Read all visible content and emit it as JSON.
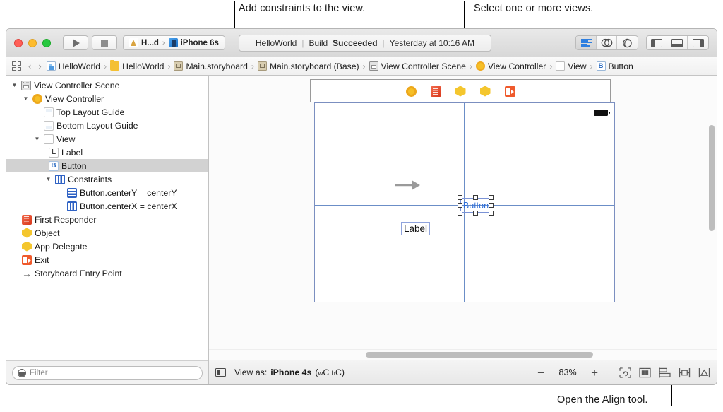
{
  "annotations": [
    {
      "id": "a1",
      "text": "Add constraints to the view."
    },
    {
      "id": "a2",
      "text": "Select one or more views."
    },
    {
      "id": "a3",
      "text": "Open the Align tool."
    }
  ],
  "toolbar": {
    "window_controls": [
      "close",
      "minimize",
      "zoom"
    ],
    "run_label": "Run",
    "stop_label": "Stop",
    "scheme": {
      "target": "H...d",
      "device": "iPhone 6s"
    },
    "status": {
      "project": "HelloWorld",
      "build_prefix": "Build",
      "build_result": "Succeeded",
      "timestamp": "Yesterday at 10:16 AM",
      "separator": "|"
    },
    "editor_modes": [
      {
        "name": "standard-editor",
        "selected": true
      },
      {
        "name": "assistant-editor",
        "selected": false
      },
      {
        "name": "version-editor",
        "selected": false
      }
    ],
    "view_toggles": [
      {
        "name": "navigator-toggle",
        "selected": false
      },
      {
        "name": "debug-area-toggle",
        "selected": false
      },
      {
        "name": "utilities-toggle",
        "selected": false
      }
    ]
  },
  "breadcrumb": {
    "back_label": "‹",
    "forward_label": "›",
    "separator": "›",
    "items": [
      {
        "label": "HelloWorld",
        "icon": "project-icon"
      },
      {
        "label": "HelloWorld",
        "icon": "folder-icon"
      },
      {
        "label": "Main.storyboard",
        "icon": "storyboard-icon"
      },
      {
        "label": "Main.storyboard (Base)",
        "icon": "storyboard-icon"
      },
      {
        "label": "View Controller Scene",
        "icon": "scene-icon"
      },
      {
        "label": "View Controller",
        "icon": "view-controller-icon"
      },
      {
        "label": "View",
        "icon": "view-icon"
      },
      {
        "label": "Button",
        "icon": "button-icon"
      }
    ]
  },
  "outline": {
    "rows": [
      {
        "label": "View Controller Scene",
        "indent": 0,
        "twisty": "▼",
        "icon": "scene",
        "selected": false
      },
      {
        "label": "View Controller",
        "indent": 1,
        "twisty": "▼",
        "icon": "vc",
        "selected": false
      },
      {
        "label": "Top Layout Guide",
        "indent": 2,
        "twisty": "",
        "icon": "guide top",
        "selected": false
      },
      {
        "label": "Bottom Layout Guide",
        "indent": 2,
        "twisty": "",
        "icon": "guide bot",
        "selected": false
      },
      {
        "label": "View",
        "indent": 2,
        "twisty": "▼",
        "icon": "view",
        "selected": false
      },
      {
        "label": "Label",
        "indent": 3,
        "twisty": "",
        "icon": "lbl",
        "glyph": "L",
        "selected": false
      },
      {
        "label": "Button",
        "indent": 3,
        "twisty": "",
        "icon": "btn",
        "glyph": "B",
        "selected": true
      },
      {
        "label": "Constraints",
        "indent": 3,
        "twisty": "▼",
        "icon": "cons",
        "selected": false
      },
      {
        "label": "Button.centerY = centerY",
        "indent": 4,
        "twisty": "",
        "icon": "consy",
        "selected": false
      },
      {
        "label": "Button.centerX = centerX",
        "indent": 4,
        "twisty": "",
        "icon": "cons",
        "selected": false
      },
      {
        "label": "First Responder",
        "indent": 1,
        "twisty": "",
        "icon": "fr",
        "selected": false
      },
      {
        "label": "Object",
        "indent": 1,
        "twisty": "",
        "icon": "obj",
        "selected": false
      },
      {
        "label": "App Delegate",
        "indent": 1,
        "twisty": "",
        "icon": "obj",
        "selected": false
      },
      {
        "label": "Exit",
        "indent": 1,
        "twisty": "",
        "icon": "exit",
        "selected": false
      },
      {
        "label": "Storyboard Entry Point",
        "indent": 1,
        "twisty": "",
        "icon": "arrow",
        "glyph": "→",
        "selected": false
      }
    ],
    "filter_placeholder": "Filter"
  },
  "canvas": {
    "dock_icons": [
      "view-controller-icon",
      "first-responder-icon",
      "object-icon",
      "object-icon",
      "exit-icon"
    ],
    "button": {
      "label": "Button",
      "selected": true,
      "handle_count": 8
    },
    "label": {
      "label": "Label"
    },
    "guide_color": "#6b8ec7",
    "selection_color": "#2f6fd8"
  },
  "bottombar": {
    "view_as_prefix": "View as:",
    "device": "iPhone 4s",
    "size_class_open": "(",
    "size_class_w_sub": "w",
    "size_class_w": "C",
    "size_class_h_sub": "h",
    "size_class_h": "C",
    "size_class_close": ")",
    "zoom_out": "−",
    "zoom_level": "83%",
    "zoom_in": "+",
    "align_tools": [
      {
        "name": "update-frames-icon"
      },
      {
        "name": "embed-in-icon"
      },
      {
        "name": "align-icon"
      },
      {
        "name": "pin-icon"
      },
      {
        "name": "resolve-auto-layout-issues-icon"
      }
    ]
  }
}
